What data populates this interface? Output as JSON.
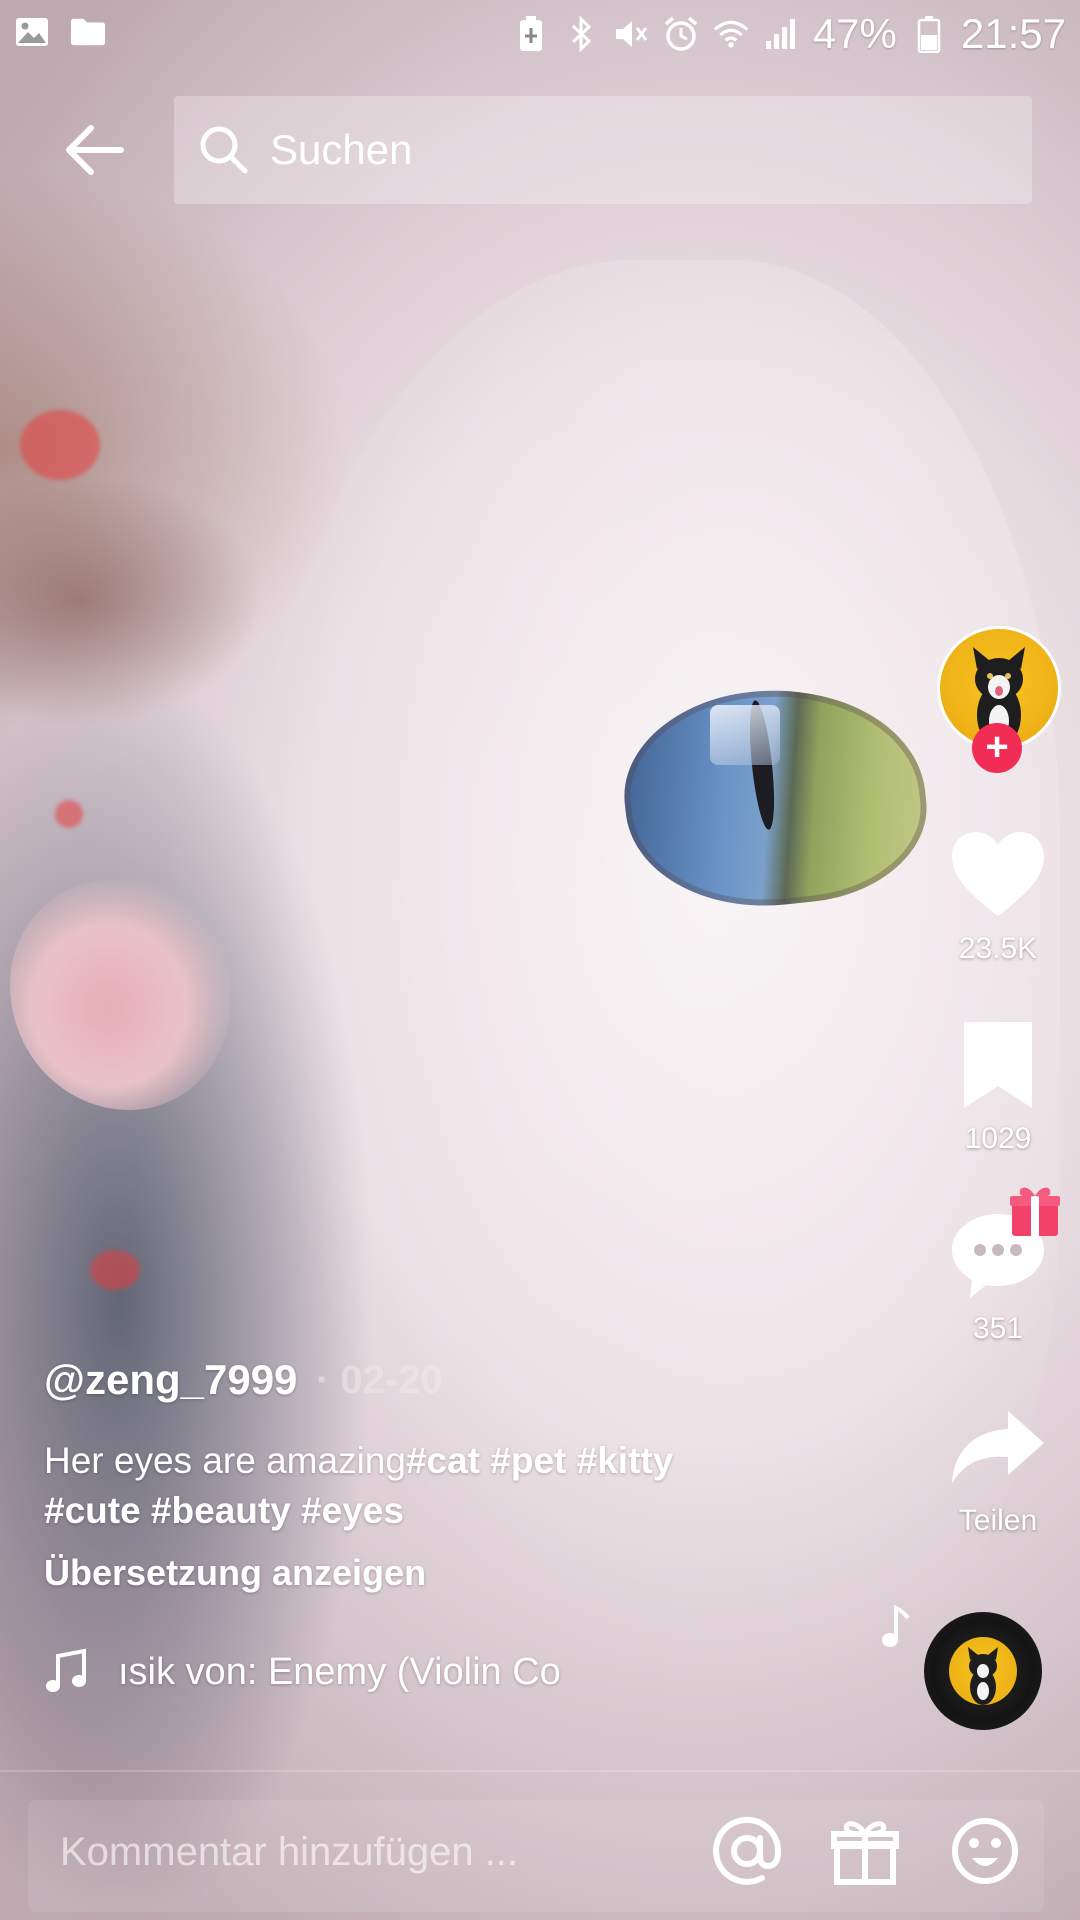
{
  "status_bar": {
    "battery_percent": "47%",
    "time": "21:57",
    "left_icons": [
      "gallery-icon",
      "folder-icon"
    ],
    "right_icons": [
      "battery-saver-icon",
      "bluetooth-icon",
      "mute-icon",
      "alarm-icon",
      "wifi-icon",
      "signal-icon",
      "battery-icon"
    ]
  },
  "search": {
    "label": "Suchen"
  },
  "actions": {
    "likes": "23.5K",
    "saves": "1029",
    "comments": "351",
    "share_label": "Teilen"
  },
  "post": {
    "username": "@zeng_7999",
    "date": "· 02-20",
    "caption_text": "Her eyes are amazing",
    "caption_tags_line1": "#cat #pet #kitty",
    "caption_tags_line2": "#cute #beauty #eyes",
    "translate_label": "Übersetzung anzeigen",
    "music_text": "ısik von: Enemy (Violin Co"
  },
  "comment_bar": {
    "placeholder": "Kommentar hinzufügen ..."
  },
  "colors": {
    "accent": "#f22d55",
    "avatar_bg": "#f0b418"
  }
}
